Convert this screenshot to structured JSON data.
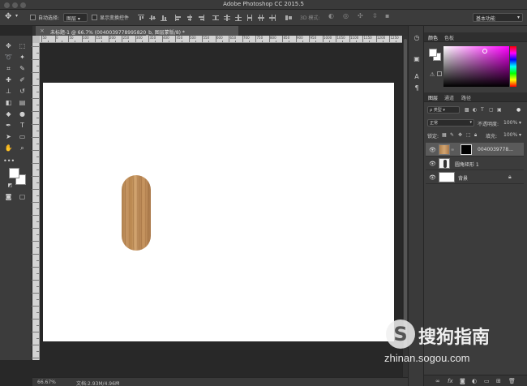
{
  "window": {
    "title": "Adobe Photoshop CC 2015.5"
  },
  "options_bar": {
    "auto_select_label": "自动选择:",
    "auto_select_target": "图层",
    "show_transform_label": "显示变换控件",
    "mode_3d_label": "3D 模式:",
    "workspace": "基本功能"
  },
  "document": {
    "tab_label": "未标题-1 @ 66.7% (0040039778995820_b, 图层蒙版/8) *",
    "zoom": "66.67%",
    "doc_size": "文档:2.93M/4.96M"
  },
  "ruler": {
    "top_labels": [
      "50",
      "0",
      "50",
      "100",
      "150",
      "200",
      "250",
      "300",
      "350",
      "400",
      "450",
      "500",
      "550",
      "600",
      "650",
      "700",
      "750",
      "800",
      "850",
      "900",
      "950",
      "1000",
      "1050",
      "1100",
      "1150",
      "1200",
      "1250"
    ]
  },
  "color_panel": {
    "tabs": [
      "颜色",
      "色板"
    ]
  },
  "layers_panel": {
    "tabs": [
      "图层",
      "通道",
      "路径"
    ],
    "filter_kind": "ρ 类型",
    "blend_mode": "正常",
    "opacity_label": "不透明度:",
    "opacity_value": "100%",
    "lock_label": "锁定:",
    "fill_label": "填充:",
    "fill_value": "100%",
    "layers": [
      {
        "name": "0040039778..."
      },
      {
        "name": "圆角矩形 1"
      },
      {
        "name": "背景"
      }
    ],
    "footer_fx": "fx"
  },
  "watermark": {
    "logo_letter": "S",
    "brand": "搜狗指南",
    "url": "zhinan.sogou.com"
  },
  "colors": {
    "canvas": "#ffffff",
    "wood_light": "#d2a571",
    "wood_dark": "#a9784a"
  }
}
